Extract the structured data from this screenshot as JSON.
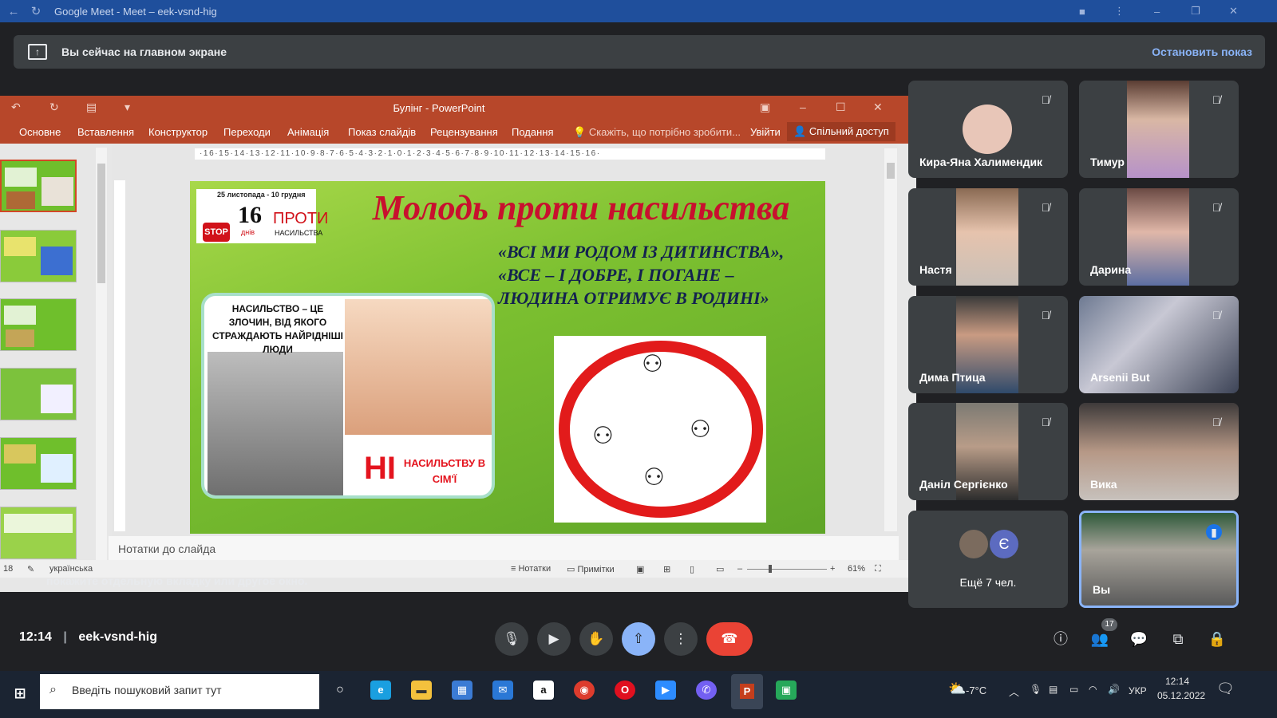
{
  "browser": {
    "title": "Google Meet - Meet – eek-vsnd-hig"
  },
  "banner": {
    "text": "Вы сейчас на главном экране",
    "stop": "Остановить показ"
  },
  "ppt": {
    "title": "Булінг - PowerPoint",
    "menu": [
      "Основне",
      "Вставлення",
      "Конструктор",
      "Переходи",
      "Анімація",
      "Показ слайдів",
      "Рецензування",
      "Подання"
    ],
    "search": "Скажіть, що потрібно зробити...",
    "login": "Увійти",
    "share": "Спільний доступ",
    "ruler": "·16·15·14·13·12·11·10·9·8·7·6·5·4·3·2·1·0·1·2·3·4·5·6·7·8·9·10·11·12·13·14·15·16·",
    "notes_placeholder": "Нотатки до слайда",
    "status": {
      "slide_count": "18",
      "language": "українська",
      "notes_btn": "Нотатки",
      "comments_btn": "Примітки",
      "zoom": "61%"
    },
    "slide": {
      "title": "Молодь проти насильства",
      "badge_date": "25 листопада - 10 грудня",
      "badge_stop": "STOP",
      "badge_num": "16",
      "badge_days": "днів",
      "badge_proty": "ПРОТИ",
      "badge_nas": "НАСИЛЬСТВА",
      "quote": "«ВСІ МИ РОДОМ ІЗ ДИТИНСТВА», «ВСЕ – І ДОБРЕ, І ПОГАНЕ – ЛЮДИНА ОТРИМУЄ В РОДИНІ»",
      "poster_head": "НАСИЛЬСТВО – ЦЕ ЗЛОЧИН, ВІД ЯКОГО СТРАЖДАЮТЬ НАЙРІДНІШІ ЛЮДИ",
      "poster_ni": "НІ",
      "poster_ni2": "НАСИЛЬСТВУ В СІМ'Ї"
    }
  },
  "under_text": "покажите отдельную вкладку или другое окно.",
  "participants": [
    {
      "name": "Кира-Яна Халимендик"
    },
    {
      "name": "Тимур"
    },
    {
      "name": "Настя"
    },
    {
      "name": "Дарина"
    },
    {
      "name": "Дима Птица"
    },
    {
      "name": "Arsenii But"
    },
    {
      "name": "Даніл Сергієнко"
    },
    {
      "name": "Вика"
    },
    {
      "name": "Ещё 7 чел.",
      "avatar_letter": "Є"
    },
    {
      "name": "Вы"
    }
  ],
  "meeting": {
    "time": "12:14",
    "code": "eek-vsnd-hig",
    "people_count": "17"
  },
  "taskbar": {
    "search": "Введіть пошуковий запит тут",
    "temp": "-7°C",
    "lang": "УКР",
    "time": "12:14",
    "date": "05.12.2022"
  }
}
